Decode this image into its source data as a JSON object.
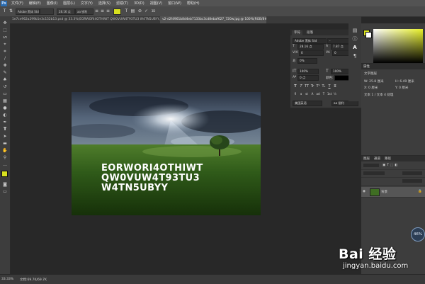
{
  "app": {
    "logo": "Ps"
  },
  "menu": [
    "文件(F)",
    "编辑(E)",
    "图像(I)",
    "图层(L)",
    "文字(Y)",
    "选择(S)",
    "滤镜(T)",
    "3D(D)",
    "视图(V)",
    "窗口(W)",
    "帮助(H)"
  ],
  "options_bar": {
    "tool_preset": "T",
    "font_family": "Adobe 黑体 Std",
    "font_style": "",
    "font_size": "28.16 点",
    "antialias": "aa 锐利",
    "icons": [
      "text-orientation-icon",
      "align-left-icon",
      "align-center-icon",
      "align-right-icon",
      "color-swatch",
      "warp-text-icon",
      "panel-toggle-icon",
      "cancel-icon",
      "commit-icon",
      "3d-icon"
    ]
  },
  "doc_tabs": [
    {
      "label": "1e7ce962a299b1e3c152b13.psd @ 33.3%(EORWORI4OTHIWT QW0VUW4T93TU3 W4TN5UBYY, RGB/8#) ×",
      "active": false
    },
    {
      "label": "v2-d2f4961b8d4eb7133bc3cd8ebaf627_720w.jpg @ 100%(RGB/8#) ×",
      "active": true
    }
  ],
  "canvas": {
    "text_lines": [
      "EORWORI4OTHIWT",
      "QW0VUW4T93TU3",
      "W4TN5UBYY"
    ]
  },
  "character_panel": {
    "tabs": [
      "字符",
      "段落"
    ],
    "font_family": "Adobe 黑体 Std",
    "font_style": "-",
    "font_size": "28.16 点",
    "leading": "7.87 点",
    "kerning": "0",
    "tracking": "0",
    "scale_label": "0%",
    "vertical_scale": "100%",
    "horizontal_scale": "100%",
    "baseline_shift": "0 点",
    "color_label": "颜色:",
    "style_buttons": [
      "T",
      "T",
      "TT",
      "Tr",
      "T¹",
      "T₁",
      "T",
      "T"
    ],
    "opentype_buttons": [
      "fi",
      "ɑ",
      "st",
      "A",
      "ad",
      "T",
      "1st",
      "½"
    ],
    "language": "美国英语",
    "antialias": "aa 锐利"
  },
  "color_panel": {
    "fg": "#d9e21f",
    "bg": "#ffffff"
  },
  "properties_panel": {
    "title": "属性",
    "subtitle": "文字图层",
    "w": "W: 25.8 厘米",
    "h": "H: 6.49 厘米",
    "x": "X: 0 厘米",
    "y": "Y: 0 厘米",
    "note": "文本 1 / 文本 4 处理"
  },
  "layers_panel": {
    "tabs": [
      "图层",
      "通道",
      "路径"
    ],
    "layer_name": "背景"
  },
  "status": {
    "zoom": "33.33%",
    "doc": "文档:69.7K/69.7K"
  },
  "watermark": {
    "badge": "46%",
    "brand": "Bai 经验",
    "url": "jingyan.baidu.com"
  }
}
